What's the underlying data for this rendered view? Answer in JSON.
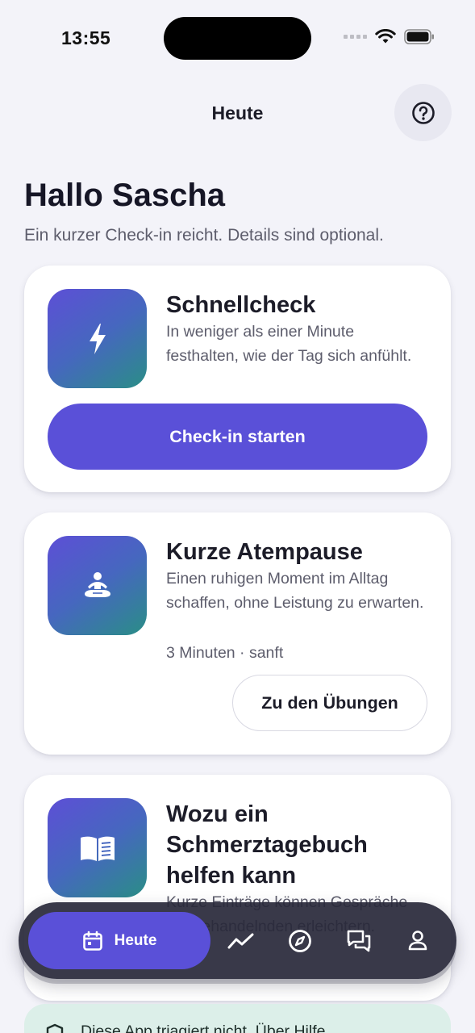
{
  "status_bar": {
    "time": "13:55"
  },
  "header": {
    "title": "Heute",
    "help_icon": "help-circle-icon"
  },
  "greeting": {
    "title": "Hallo Sascha",
    "subtitle": "Ein kurzer Check-in reicht. Details sind optional."
  },
  "cards": [
    {
      "icon": "lightning-icon",
      "title": "Schnellcheck",
      "text": "In weniger als einer Minute festhalten, wie der Tag sich anfühlt.",
      "button": "Check-in starten"
    },
    {
      "icon": "meditation-icon",
      "title": "Kurze Atempause",
      "text": "Einen ruhigen Moment im Alltag schaffen, ohne Leistung zu erwarten.",
      "meta": "3 Minuten · sanft",
      "button": "Zu den Übungen"
    },
    {
      "icon": "book-icon",
      "title": "Wozu ein Schmerztagebuch helfen kann",
      "text": "Kurze Einträge können Gespräche mit Behandelnden erleichtern."
    }
  ],
  "tabbar": {
    "active_label": "Heute",
    "items": [
      "calendar-icon",
      "trend-icon",
      "compass-icon",
      "chat-icon",
      "profile-icon"
    ]
  },
  "notice": {
    "text": "Diese App triagiert nicht. Über Hilfe"
  },
  "colors": {
    "accent": "#5a50d8",
    "background": "#f3f3f9",
    "tabbar": "#28283a",
    "notice": "#dcefe9"
  }
}
